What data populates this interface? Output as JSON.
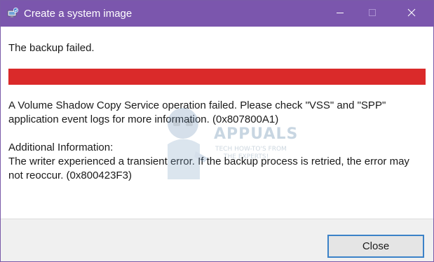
{
  "window": {
    "title": "Create a system image",
    "icons": {
      "app": "system-image-icon",
      "minimize": "minimize-icon",
      "maximize": "maximize-icon",
      "close": "close-icon"
    }
  },
  "content": {
    "heading": "The backup failed.",
    "progress": {
      "fraction": 1.0,
      "color": "#da2a2a"
    },
    "error_line1": "A Volume Shadow Copy Service operation failed. Please check \"VSS\" and \"SPP\"",
    "error_line2": "application event logs for more information. (0x807800A1)",
    "additional_heading": "Additional Information:",
    "additional_line1": "The writer experienced a transient error.  If the backup process is retried, the error may",
    "additional_line2": "not reoccur. (0x800423F3)"
  },
  "watermark": {
    "brand": "APPUALS",
    "tagline1": "TECH HOW-TO'S FROM",
    "tagline2": "THE EXPERTS!"
  },
  "footer": {
    "close_label": "Close"
  },
  "colors": {
    "titlebar": "#7b56ad",
    "error_bar": "#da2a2a",
    "button_focus_border": "#3b82c8"
  }
}
